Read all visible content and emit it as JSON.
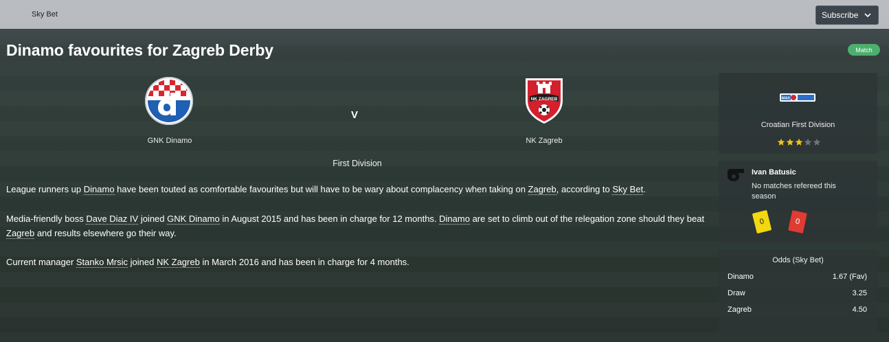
{
  "topbar": {
    "brand": "Sky Bet",
    "subscribe_label": "Subscribe"
  },
  "article": {
    "title": "Dinamo favourites for Zagreb Derby",
    "badge": "Match",
    "home_team": "GNK Dinamo",
    "away_team": "NK Zagreb",
    "versus": "V",
    "division": "First Division",
    "p1": [
      {
        "t": "League runners up ",
        "link": false
      },
      {
        "t": "Dinamo",
        "link": true
      },
      {
        "t": " have been touted as comfortable favourites but will have to be wary about complacency when taking on ",
        "link": false
      },
      {
        "t": "Zagreb",
        "link": true
      },
      {
        "t": ", according to ",
        "link": false
      },
      {
        "t": "Sky Bet",
        "link": true
      },
      {
        "t": ".",
        "link": false
      }
    ],
    "p2": [
      {
        "t": "Media-friendly boss ",
        "link": false
      },
      {
        "t": "Dave Diaz IV",
        "link": true
      },
      {
        "t": " joined ",
        "link": false
      },
      {
        "t": "GNK Dinamo",
        "link": true
      },
      {
        "t": " in August 2015 and has been in charge for 12 months. ",
        "link": false
      },
      {
        "t": "Dinamo",
        "link": true
      },
      {
        "t": " are set to climb out of the relegation zone should they beat ",
        "link": false
      },
      {
        "t": "Zagreb",
        "link": true
      },
      {
        "t": " and results elsewhere go their way.",
        "link": false
      }
    ],
    "p3": [
      {
        "t": "Current manager ",
        "link": false
      },
      {
        "t": "Stanko Mrsic",
        "link": true
      },
      {
        "t": " joined ",
        "link": false
      },
      {
        "t": "NK Zagreb",
        "link": true
      },
      {
        "t": " in March 2016 and has been in charge for 4 months.",
        "link": false
      }
    ]
  },
  "competition": {
    "name": "Croatian First Division",
    "rating": 3,
    "rating_max": 5,
    "logo_text": "MAX"
  },
  "referee": {
    "name": "Ivan Batusic",
    "note": "No matches refereed this season",
    "yellow_cards": "0",
    "red_cards": "0"
  },
  "odds": {
    "title": "Odds (Sky Bet)",
    "rows": [
      {
        "label": "Dinamo",
        "value": "1.67 (Fav)"
      },
      {
        "label": "Draw",
        "value": "3.25"
      },
      {
        "label": "Zagreb",
        "value": "4.50"
      }
    ]
  },
  "colors": {
    "accent_green": "#4caf6e",
    "star_on": "#f0c419",
    "star_off": "#6d7576"
  }
}
